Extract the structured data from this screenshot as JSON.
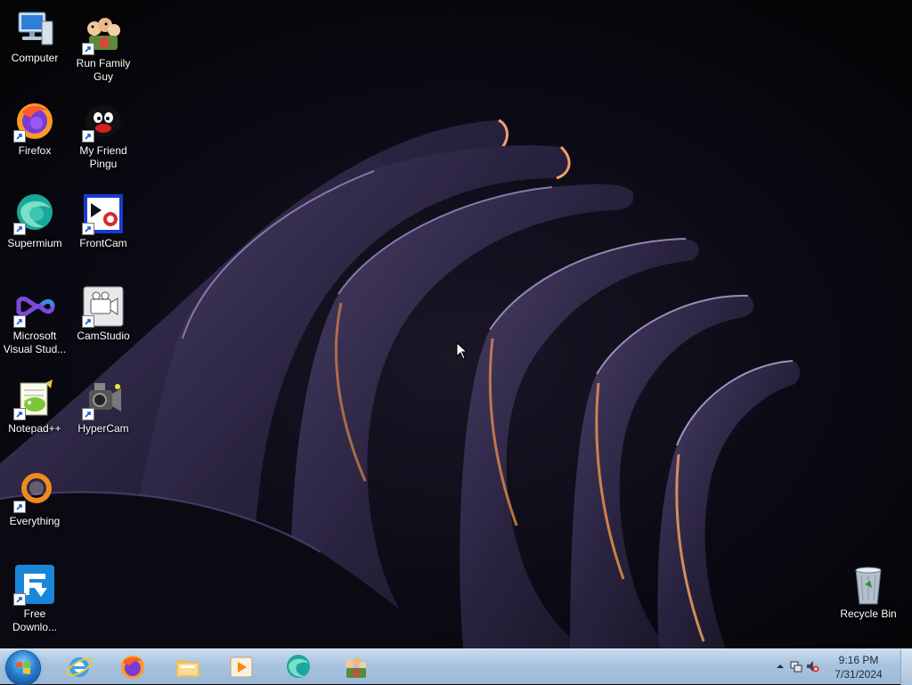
{
  "desktop": {
    "icons": [
      {
        "label": "Computer",
        "icon": "computer-icon"
      },
      {
        "label": "Run Family Guy",
        "icon": "family-guy-icon"
      },
      {
        "label": "Firefox",
        "icon": "firefox-icon"
      },
      {
        "label": "My Friend Pingu",
        "icon": "pingu-icon"
      },
      {
        "label": "Supermium",
        "icon": "supermium-icon"
      },
      {
        "label": "FrontCam",
        "icon": "frontcam-icon"
      },
      {
        "label": "Microsoft Visual Stud...",
        "icon": "visual-studio-icon"
      },
      {
        "label": "CamStudio",
        "icon": "camstudio-icon"
      },
      {
        "label": "Notepad++",
        "icon": "notepad-plus-plus-icon"
      },
      {
        "label": "HyperCam",
        "icon": "hypercam-icon"
      },
      {
        "label": "Everything",
        "icon": "everything-icon"
      },
      {
        "label": "Free Downlo...",
        "icon": "free-download-manager-icon"
      },
      {
        "label": "Recycle Bin",
        "icon": "recycle-bin-icon"
      }
    ]
  },
  "taskbar": {
    "start_icon": "windows-start-orb-icon",
    "pinned": [
      {
        "icon": "internet-explorer-icon"
      },
      {
        "icon": "firefox-icon"
      },
      {
        "icon": "file-explorer-icon"
      },
      {
        "icon": "media-player-icon"
      },
      {
        "icon": "supermium-icon"
      },
      {
        "icon": "family-guy-icon"
      }
    ],
    "tray": {
      "icons": [
        "chevron-up-icon",
        "network-icon",
        "volume-muted-icon"
      ],
      "time": "9:16 PM",
      "date": "7/31/2024"
    }
  },
  "colors": {
    "wallpaper_base": "#06060c",
    "taskbar": "#a8c3de",
    "accent_orange": "#e8823a",
    "accent_violet": "#6a5a9a"
  }
}
